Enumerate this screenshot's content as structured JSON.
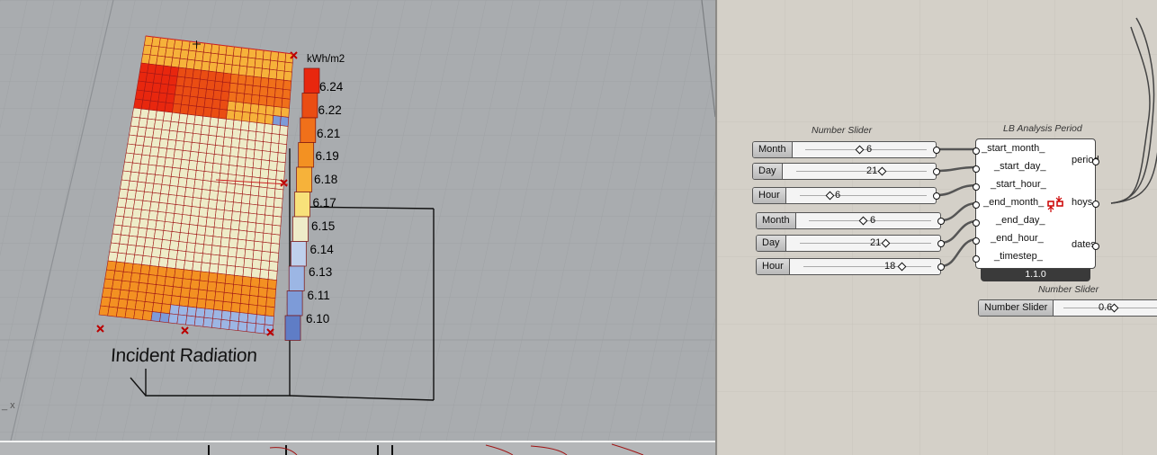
{
  "viewport": {
    "legend_unit": "kWh/m2",
    "legend_values": [
      "6.24",
      "6.22",
      "6.21",
      "6.19",
      "6.18",
      "6.17",
      "6.15",
      "6.14",
      "6.13",
      "6.11",
      "6.10"
    ],
    "legend_colors": [
      "#e8270e",
      "#ea4d13",
      "#f0701a",
      "#f39122",
      "#f6b23a",
      "#f8e17a",
      "#eeecc8",
      "#bfd0ec",
      "#9cb6e4",
      "#7d9bd8",
      "#5f7dc6"
    ],
    "title": "Incident Radiation",
    "axis_label": "_ x"
  },
  "canvas": {
    "slider_group_title": "Number Slider",
    "sliders": [
      {
        "name": "Month",
        "value": "6"
      },
      {
        "name": "Day",
        "value": "21"
      },
      {
        "name": "Hour",
        "value": "6"
      },
      {
        "name": "Month",
        "value": "6"
      },
      {
        "name": "Day",
        "value": "21"
      },
      {
        "name": "Hour",
        "value": "18"
      }
    ],
    "component": {
      "title": "LB Analysis Period",
      "inputs": [
        "_start_month_",
        "_start_day_",
        "_start_hour_",
        "_end_month_",
        "_end_day_",
        "_end_hour_",
        "_timestep_"
      ],
      "outputs": [
        "period",
        "hoys",
        "dates"
      ],
      "version": "1.1.0"
    },
    "extra_slider": {
      "title": "Number Slider",
      "name": "Number Slider",
      "value": "0.6"
    }
  }
}
